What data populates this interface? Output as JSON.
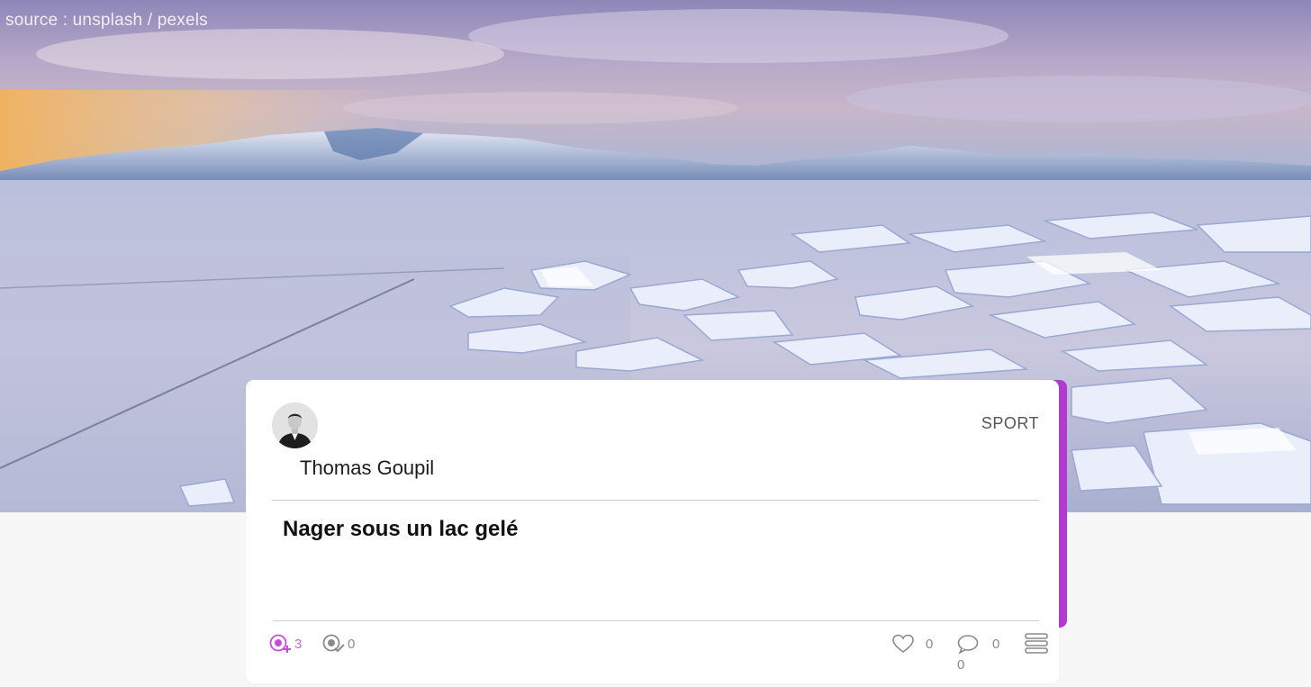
{
  "hero": {
    "credit": "source : unsplash / pexels"
  },
  "post": {
    "author": "Thomas Goupil",
    "category": "SPORT",
    "title": "Nager sous un lac gelé",
    "stats": {
      "followers": "3",
      "validations": "0",
      "likes": "0",
      "comments": "0",
      "extra_count": "0"
    }
  },
  "colors": {
    "accent": "#b23ad1",
    "follower_icon": "#c94bdc",
    "muted_icon": "#8a8a8a"
  },
  "icons": {
    "followers": "add-follower-icon",
    "validations": "validation-check-icon",
    "likes": "heart-icon",
    "comments": "comment-bubble-icon",
    "menu": "stack-menu-icon"
  }
}
